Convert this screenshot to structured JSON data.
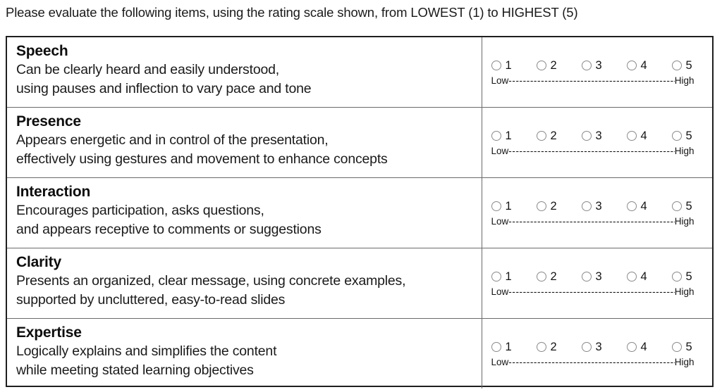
{
  "instruction": "Please evaluate the following items, using the rating scale shown, from LOWEST (1) to HIGHEST (5)",
  "scale": {
    "options": [
      {
        "value": "1"
      },
      {
        "value": "2"
      },
      {
        "value": "3"
      },
      {
        "value": "4"
      },
      {
        "value": "5"
      }
    ],
    "low_label": "Low",
    "high_label": "High",
    "dashes": "------------------------------------------------"
  },
  "items": [
    {
      "title": "Speech",
      "line1": "Can be clearly heard and easily understood,",
      "line2": "using pauses and inflection to vary pace and tone"
    },
    {
      "title": "Presence",
      "line1": "Appears energetic and in control of the presentation,",
      "line2": "effectively using gestures and movement to enhance concepts"
    },
    {
      "title": "Interaction",
      "line1": "Encourages participation, asks questions,",
      "line2": "and appears receptive to comments or suggestions"
    },
    {
      "title": "Clarity",
      "line1": "Presents an organized, clear message, using concrete examples,",
      "line2": "supported by uncluttered, easy-to-read slides"
    },
    {
      "title": "Expertise",
      "line1": "Logically explains and simplifies the content",
      "line2": "while meeting stated learning objectives"
    }
  ]
}
